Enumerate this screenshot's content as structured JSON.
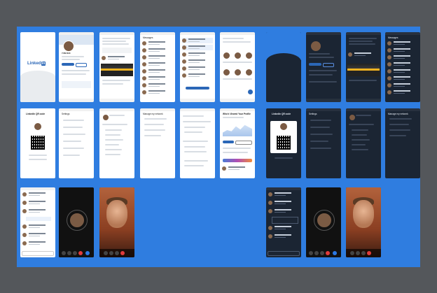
{
  "board": {
    "background": "#2f7de0",
    "frame": "#54575b"
  },
  "screens": {
    "splash_logo": "Linked",
    "splash_logo_suffix": "in",
    "profile_name": "YUW DUO",
    "messages_title": "Messages",
    "notifications_title": "Notifications",
    "qr_title": "LinkedIn QR code",
    "settings_title": "Settings",
    "viewers_title": "Who's Viewed Your Profile",
    "menu_title": "Manage my network"
  },
  "colors": {
    "linkedin_blue": "#2b67b7",
    "dark_bg": "#1b2533",
    "light_bg": "#ffffff"
  }
}
